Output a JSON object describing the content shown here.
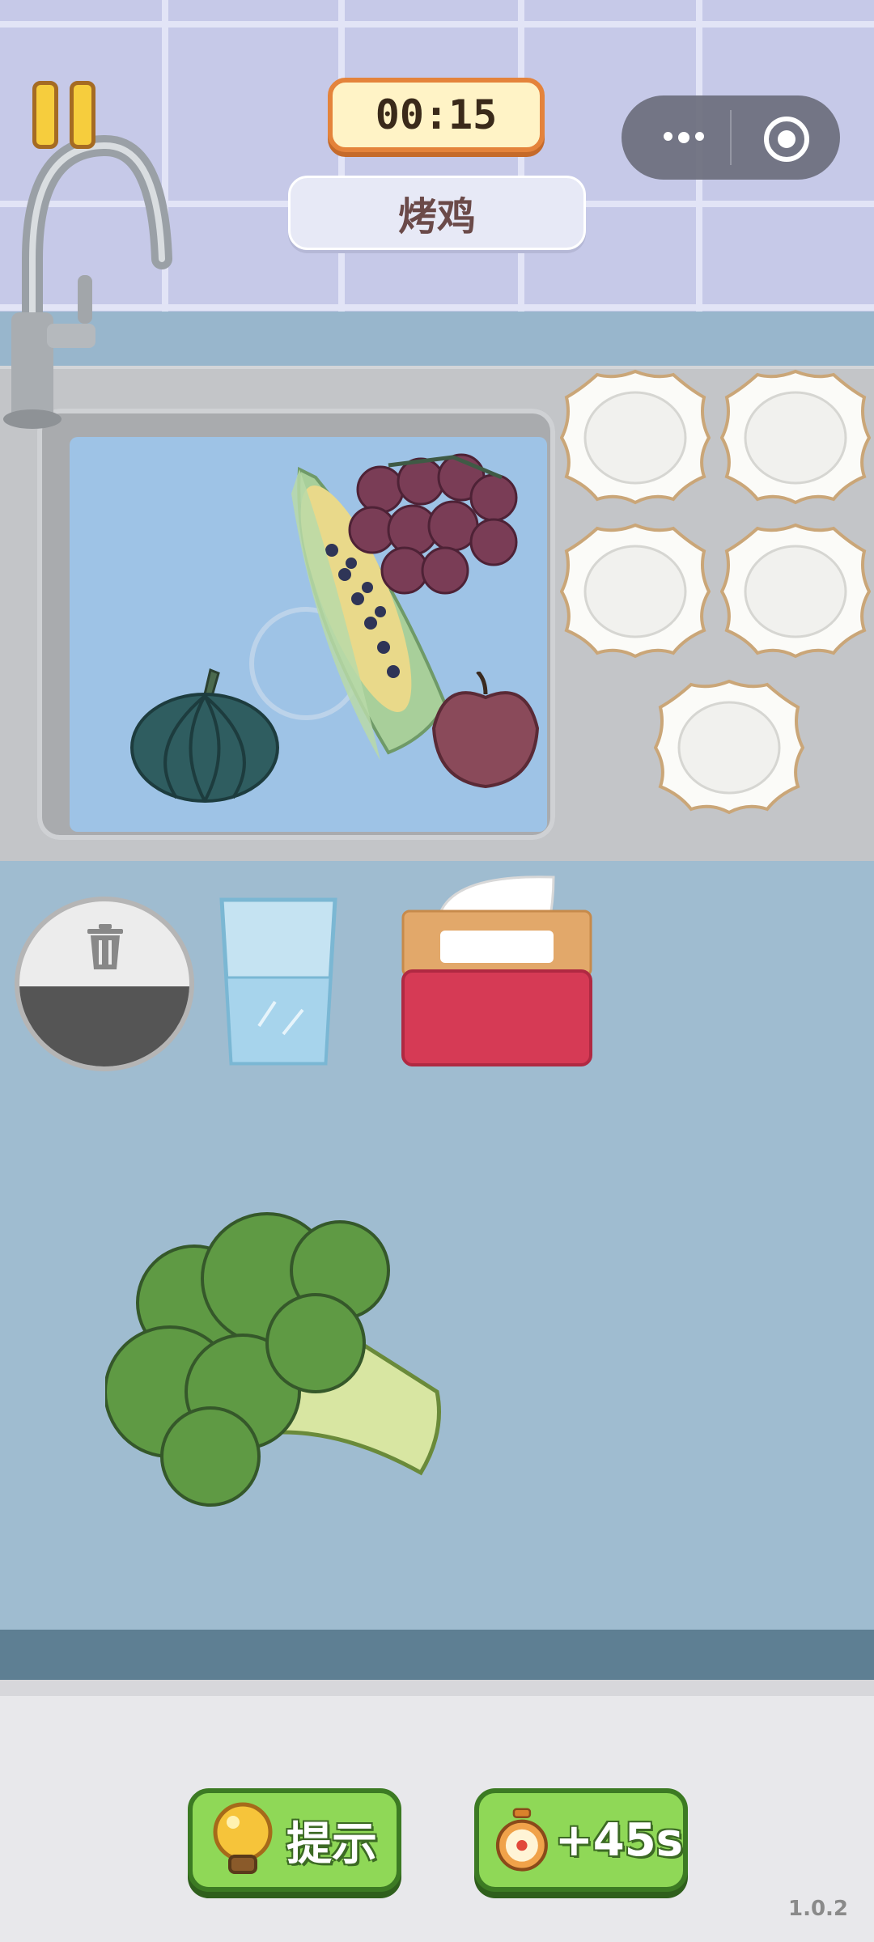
{
  "hud": {
    "timer": "00:15",
    "dish_name": "烤鸡"
  },
  "buttons": {
    "hint_label": "提示",
    "time_bonus_label": "+45s"
  },
  "version": "1.0.2",
  "items": {
    "in_sink": [
      "pumpkin-icon",
      "corn-icon",
      "grapes-icon",
      "apple-icon"
    ],
    "on_counter": [
      "broccoli-icon"
    ],
    "tools": [
      "trash-icon",
      "glass-icon",
      "tissue-box-icon",
      "plate-icon"
    ]
  },
  "plates_count": 5,
  "colors": {
    "timer_border": "#e4833b",
    "button_green": "#8fd857",
    "water": "#9ec3e6"
  }
}
